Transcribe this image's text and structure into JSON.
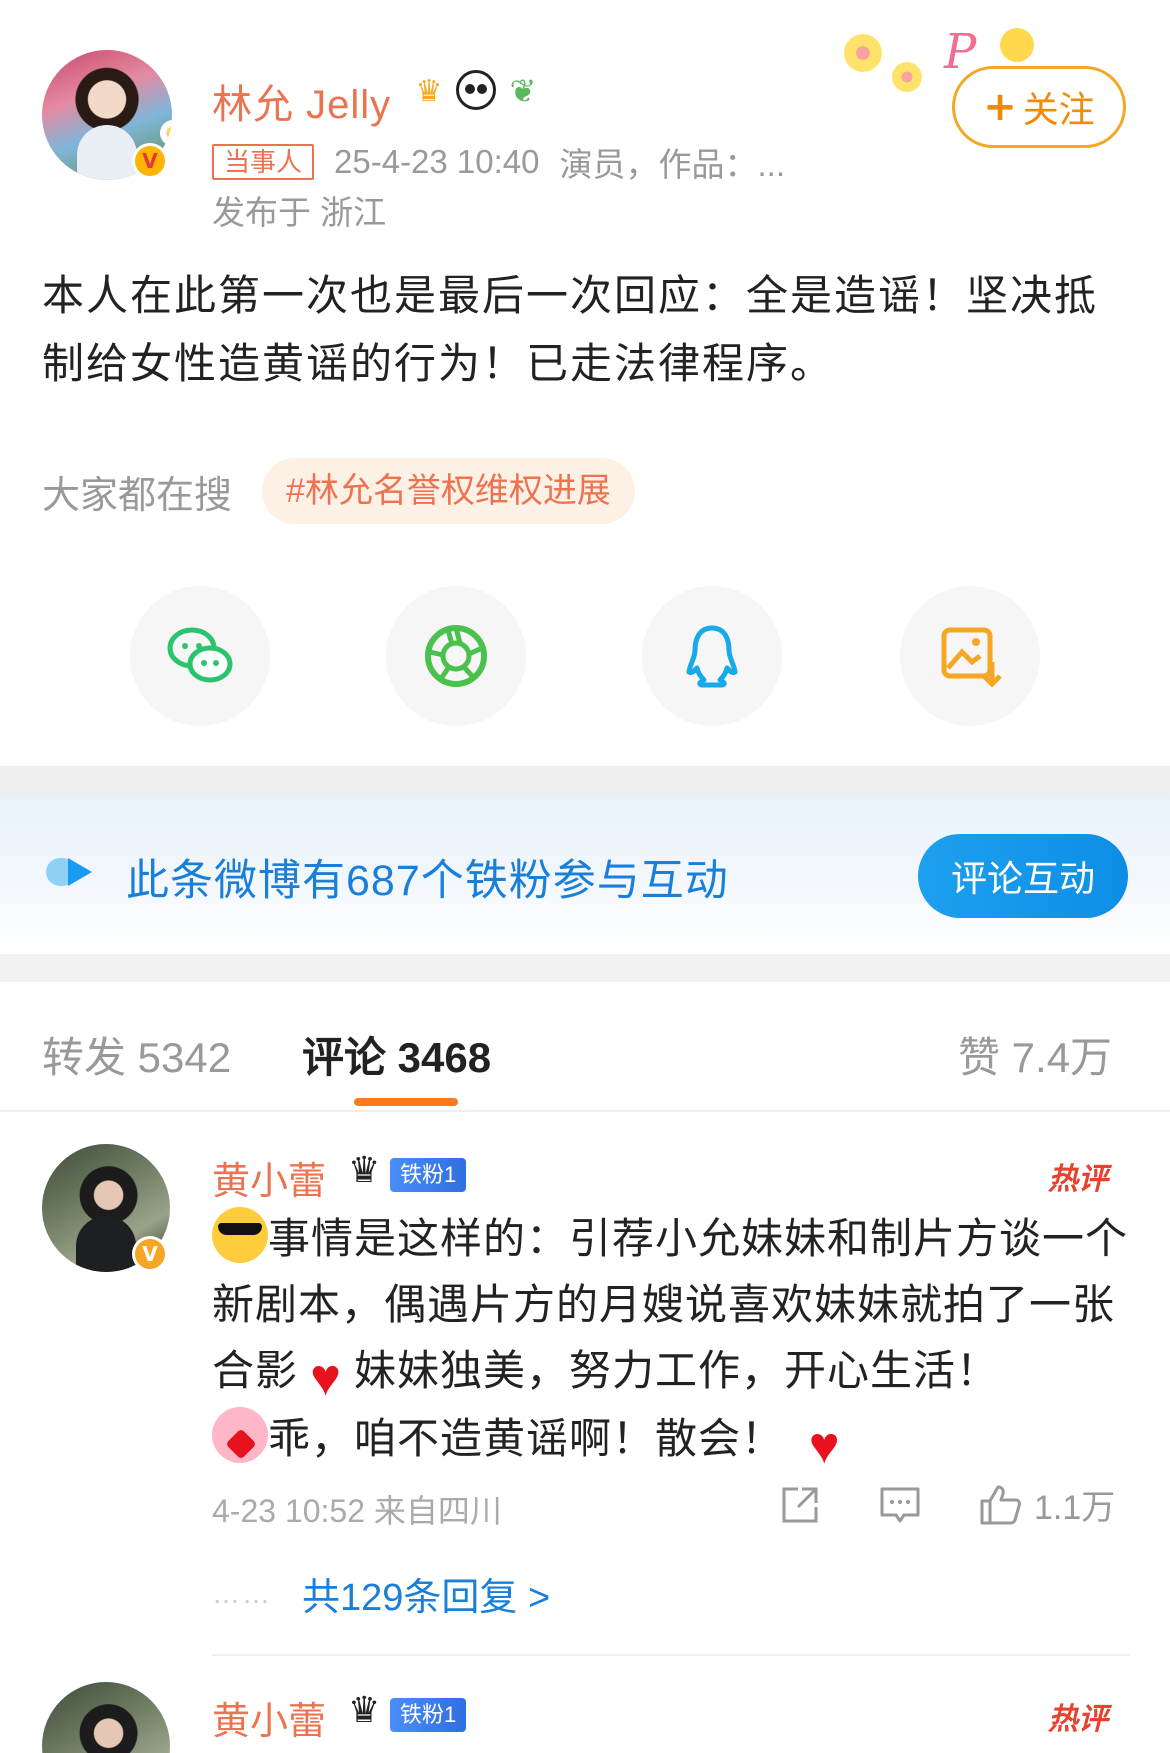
{
  "post": {
    "author": "林允 Jelly",
    "party_tag": "当事人",
    "time": "25-4-23 10:40",
    "bio": "演员，作品：...",
    "location": "发布于 浙江",
    "follow_label": "关注",
    "follow_plus": "+",
    "verified": "V",
    "text": "本人在此第一次也是最后一次回应：全是造谣！坚决抵制给女性造黄谣的行为！已走法律程序。"
  },
  "search": {
    "label": "大家都在搜",
    "topic": "#林允名誉权维权进展"
  },
  "share": {
    "icons": [
      "wechat-icon",
      "moments-icon",
      "qq-icon",
      "save-image-icon"
    ]
  },
  "fans_banner": {
    "text": "此条微博有687个铁粉参与互动",
    "button": "评论互动"
  },
  "tabs": {
    "repost": "转发 5342",
    "comment": "评论 3468",
    "like": "赞 7.4万"
  },
  "comments": [
    {
      "name": "黄小蕾",
      "fan_badge": "铁粉1",
      "hot": "热评",
      "verified": "V",
      "text_part1": "事情是这样的：引荐小允妹妹和制片方谈一个新剧本，偶遇片方的月嫂说喜欢妹妹就拍了一张合影",
      "text_part2": "妹妹独美，努力工作，开心生活！",
      "text_part3": "乖，咱不造黄谣啊！散会！",
      "time": "4-23 10:52  来自四川",
      "likes": "1.1万",
      "dots": "……",
      "replies": "共129条回复 >"
    },
    {
      "name": "黄小蕾",
      "fan_badge": "铁粉1",
      "hot": "热评",
      "verified": "V"
    }
  ],
  "colors": {
    "accent_orange": "#eb7350",
    "link_blue": "#1a7fd8",
    "hot_red": "#e8412e"
  }
}
